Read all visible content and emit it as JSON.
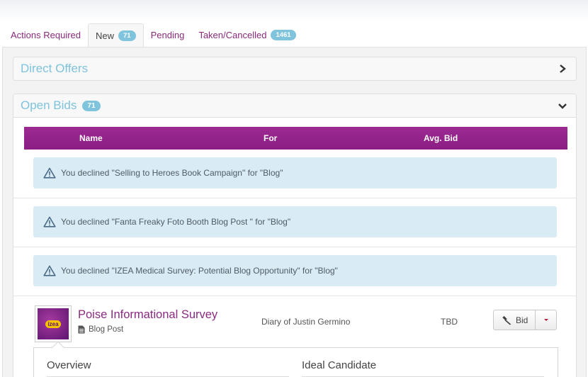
{
  "tabs": [
    {
      "label": "Actions Required",
      "badge": null,
      "active": false
    },
    {
      "label": "New",
      "badge": "71",
      "active": true
    },
    {
      "label": "Pending",
      "badge": null,
      "active": false
    },
    {
      "label": "Taken/Cancelled",
      "badge": "1461",
      "active": false
    }
  ],
  "direct_offers": {
    "title": "Direct Offers"
  },
  "open_bids": {
    "title": "Open Bids",
    "count": "71",
    "columns": {
      "name": "Name",
      "for": "For",
      "avg_bid": "Avg. Bid"
    },
    "declined": [
      "You declined \"Selling to Heroes Book Campaign\" for \"Blog\"",
      "You declined \"Fanta Freaky Foto Booth Blog Post \" for \"Blog\"",
      "You declined \"IZEA Medical Survey: Potential Blog Opportunity\" for \"Blog\""
    ],
    "item": {
      "title": "Poise Informational Survey",
      "type": "Blog Post",
      "for": "Diary of Justin Germino",
      "avg_bid": "TBD",
      "bid_label": "Bid",
      "logo_text": "izea",
      "overview_label": "Overview",
      "ideal_candidate_label": "Ideal Candidate"
    }
  },
  "colors": {
    "accent_purple": "#8b1d84",
    "link_purple": "#8b2a82",
    "badge_blue": "#7fc4dc",
    "alert_bg": "#d9ebf5",
    "section_title": "#7ec3dd"
  }
}
